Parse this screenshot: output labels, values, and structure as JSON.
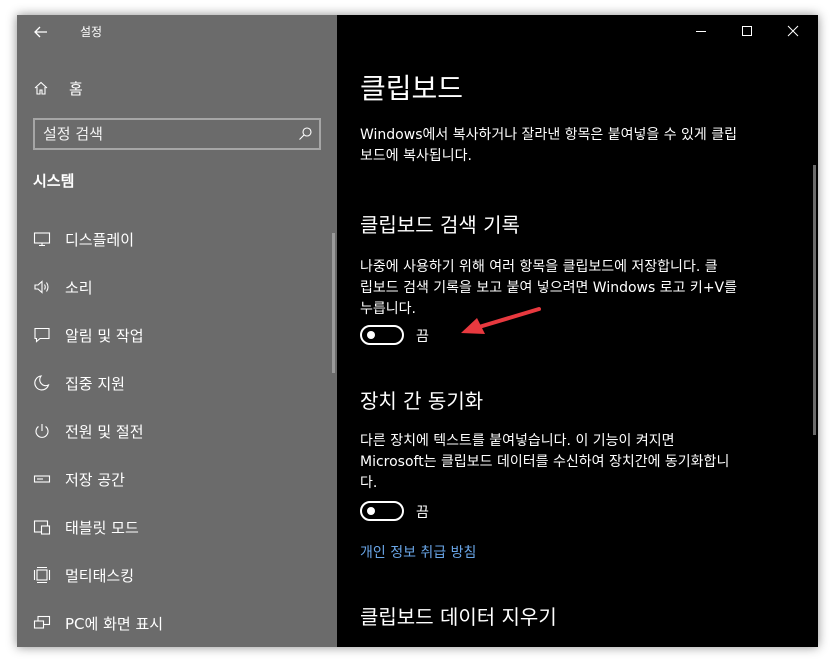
{
  "window": {
    "app_title": "설정"
  },
  "sidebar": {
    "home_label": "홈",
    "search_placeholder": "설정 검색",
    "section_title": "시스템",
    "items": [
      {
        "label": "디스플레이",
        "icon": "monitor-icon"
      },
      {
        "label": "소리",
        "icon": "speaker-icon"
      },
      {
        "label": "알림 및 작업",
        "icon": "notification-icon"
      },
      {
        "label": "집중 지원",
        "icon": "moon-icon"
      },
      {
        "label": "전원 및 절전",
        "icon": "power-icon"
      },
      {
        "label": "저장 공간",
        "icon": "storage-icon"
      },
      {
        "label": "태블릿 모드",
        "icon": "tablet-icon"
      },
      {
        "label": "멀티태스킹",
        "icon": "multitasking-icon"
      },
      {
        "label": "PC에 화면 표시",
        "icon": "project-icon"
      }
    ]
  },
  "main": {
    "page_title": "클립보드",
    "intro_line1": "Windows에서 복사하거나 잘라낸 항목은 붙여넣을 수 있게 클립",
    "intro_line2": "보드에 복사됩니다.",
    "history": {
      "heading": "클립보드 검색 기록",
      "desc_line1": "나중에 사용하기 위해 여러 항목을 클립보드에 저장합니다. 클",
      "desc_line2": "립보드 검색 기록을 보고 붙여 넣으려면 Windows 로고 키+V를",
      "desc_line3": "누릅니다.",
      "toggle_state": "끔"
    },
    "sync": {
      "heading": "장치 간 동기화",
      "desc_line1": "다른 장치에 텍스트를 붙여넣습니다. 이 기능이 켜지면",
      "desc_line2": "Microsoft는 클립보드 데이터를 수신하여 장치간에 동기화합니",
      "desc_line3": "다.",
      "toggle_state": "끔"
    },
    "privacy_link": "개인 정보 취급 방침",
    "clear_heading": "클립보드 데이터 지우기"
  },
  "colors": {
    "sidebar_bg": "#6b6b6b",
    "main_bg": "#000000",
    "link": "#69a5e6",
    "annotation_arrow": "#e8393f"
  }
}
